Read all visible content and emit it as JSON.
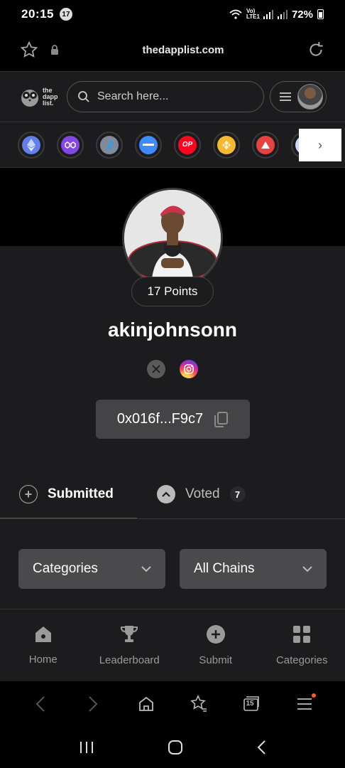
{
  "status_bar": {
    "time": "20:15",
    "notification_count": "17",
    "network": "Vo) LTE1",
    "battery": "72%"
  },
  "browser": {
    "url": "thedapplist.com",
    "tab_count": "15"
  },
  "header": {
    "logo_text": [
      "the",
      "dapp",
      "list."
    ],
    "search_placeholder": "Search here..."
  },
  "chains": [
    {
      "name": "ethereum-icon",
      "color": "#627eea",
      "label": ""
    },
    {
      "name": "polygon-icon",
      "color": "#8247e5",
      "label": ""
    },
    {
      "name": "arbitrum-icon",
      "color": "#28a0f0",
      "label": ""
    },
    {
      "name": "linea-icon",
      "color": "#3d8bfd",
      "label": ""
    },
    {
      "name": "optimism-icon",
      "color": "#ff0420",
      "label": "OP"
    },
    {
      "name": "bnb-icon",
      "color": "#f3ba2f",
      "label": ""
    },
    {
      "name": "avalanche-icon",
      "color": "#e84142",
      "label": ""
    },
    {
      "name": "chain-more-icon",
      "color": "#cfd6ff",
      "label": ""
    }
  ],
  "profile": {
    "points": "17 Points",
    "username": "akinjohnsonn",
    "wallet": "0x016f...F9c7"
  },
  "tabs": {
    "submitted": "Submitted",
    "voted": "Voted",
    "voted_count": "7"
  },
  "filters": {
    "categories": "Categories",
    "chains": "All Chains"
  },
  "bottom_nav": [
    {
      "label": "Home"
    },
    {
      "label": "Leaderboard"
    },
    {
      "label": "Submit"
    },
    {
      "label": "Categories"
    }
  ]
}
